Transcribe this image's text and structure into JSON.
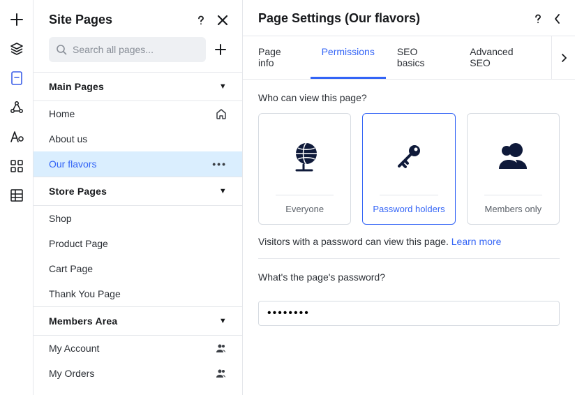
{
  "rail": {
    "items": [
      "add",
      "layers",
      "page",
      "share",
      "text",
      "grid",
      "table"
    ],
    "active_index": 2
  },
  "sidebar": {
    "title": "Site Pages",
    "search_placeholder": "Search all pages...",
    "groups": [
      {
        "label": "Main Pages",
        "items": [
          {
            "label": "Home",
            "trail": "home-icon"
          },
          {
            "label": "About us"
          },
          {
            "label": "Our flavors",
            "selected": true,
            "trail": "more"
          }
        ]
      },
      {
        "label": "Store Pages",
        "items": [
          {
            "label": "Shop"
          },
          {
            "label": "Product Page"
          },
          {
            "label": "Cart Page"
          },
          {
            "label": "Thank You Page"
          }
        ]
      },
      {
        "label": "Members Area",
        "items": [
          {
            "label": "My Account",
            "trail": "members-icon"
          },
          {
            "label": "My Orders",
            "trail": "members-icon"
          }
        ]
      }
    ]
  },
  "settings": {
    "title": "Page Settings (Our flavors)",
    "tabs": [
      "Page info",
      "Permissions",
      "SEO basics",
      "Advanced SEO"
    ],
    "active_tab_index": 1,
    "permissions": {
      "question": "Who can view this page?",
      "options": [
        {
          "label": "Everyone",
          "icon": "globe"
        },
        {
          "label": "Password holders",
          "icon": "key",
          "selected": true
        },
        {
          "label": "Members only",
          "icon": "members"
        }
      ],
      "description_plain": "Visitors with a password can view this page. ",
      "description_link": "Learn more",
      "password_label": "What's the page's password?",
      "password_value": "••••••••"
    }
  },
  "colors": {
    "accent": "#3364f6"
  }
}
